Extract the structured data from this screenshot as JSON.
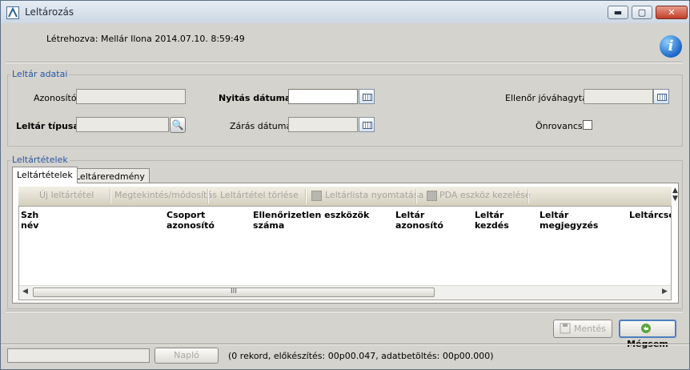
{
  "window": {
    "title": "Leltározás",
    "minimize_symbol": "▬",
    "maximize_symbol": "▢",
    "close_symbol": "✕"
  },
  "header": {
    "created_by": "Létrehozva: Mellár Ilona 2014.07.10. 8:59:49",
    "info_icon": "info-icon",
    "info_symbol": "i"
  },
  "inventory_data": {
    "group_title": "Leltár adatai",
    "id_label": "Azonosító:",
    "id_value": "",
    "open_date_label": "Nyitás dátuma:",
    "open_date_value": "",
    "close_date_label": "Zárás dátuma:",
    "close_date_value": "",
    "approved_label": "Ellenőr jóváhagyta:",
    "approved_value": "",
    "type_label": "Leltár típusa:",
    "type_value": "",
    "self_check_label": "Önrovancs:",
    "self_check_checked": false
  },
  "items_section": {
    "group_title": "Leltártételek",
    "tabs": [
      {
        "label": "Leltártételek",
        "active": true
      },
      {
        "label": "Leltáreredmény",
        "active": false
      }
    ],
    "toolbar": {
      "new_item": "Új leltártétel",
      "view_edit": "Megtekintés/módosítás",
      "delete_item": "Leltártétel törlése",
      "print_list": "Leltárlista nyomtatása",
      "pda_manage": "PDA eszköz kezelése"
    },
    "columns": [
      {
        "line1": "Szh",
        "line2": "név"
      },
      {
        "line1": "Csoport",
        "line2": "azonosító"
      },
      {
        "line1": "Ellenőrizetlen eszközök",
        "line2": "száma"
      },
      {
        "line1": "Leltár",
        "line2": "azonosító"
      },
      {
        "line1": "Leltár",
        "line2": "kezdés"
      },
      {
        "line1": "Leltár",
        "line2": "megjegyzés"
      },
      {
        "line1": "Leltárcsop",
        "line2": ""
      }
    ],
    "rows": [],
    "scroll_grip": "III",
    "scroll_left": "◀",
    "scroll_right": "▶",
    "scroll_up": "▲",
    "scroll_down": "▼"
  },
  "footer": {
    "save_label": "Mentés",
    "cancel_label": "Mégsem",
    "log_label": "Napló",
    "status_field_value": "",
    "status_text": "(0 rekord, előkészítés: 00p00.047, adatbetöltés: 00p00.000)"
  },
  "colors": {
    "group_title": "#2456a6",
    "window_bg": "#d5d3cd",
    "focus_border": "#4d7fbf"
  }
}
